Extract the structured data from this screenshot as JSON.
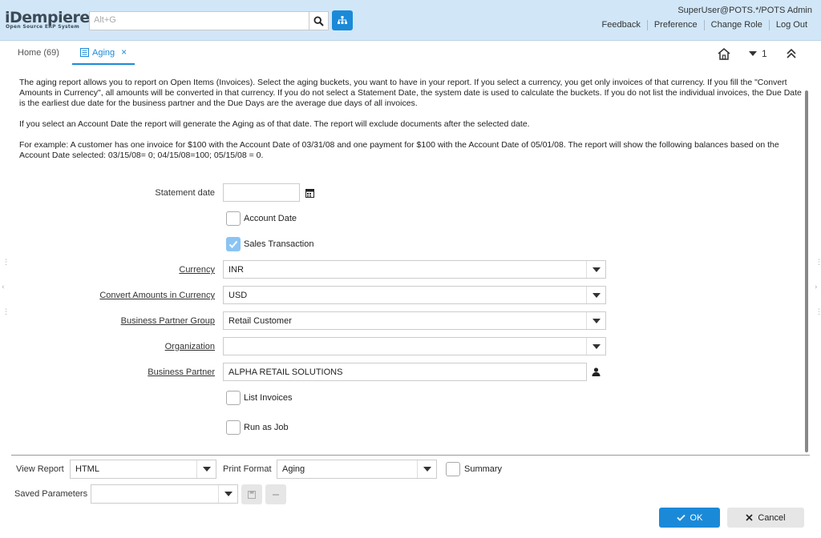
{
  "header": {
    "logo_text": "iDempiere",
    "logo_sub": "Open Source ERP System",
    "search_placeholder": "Alt+G",
    "user": "SuperUser@POTS.*/POTS Admin",
    "links": [
      "Feedback",
      "Preference",
      "Change Role",
      "Log Out"
    ]
  },
  "tabs": {
    "home_label": "Home (69)",
    "active_label": "Aging",
    "window_count": "1"
  },
  "description": {
    "p1": "The aging report allows you to report on Open Items (Invoices). Select the aging buckets, you want to have in your report. If you select a currency, you get only invoices of that currency. If you fill the \"Convert Amounts in Currency\", all amounts will be converted in that currency. If you do not select a Statement Date, the system date is used to calculate the buckets. If you do not list the individual invoices, the Due Date is the earliest due date for the business partner and the Due Days are the average due days of all invoices.",
    "p2": "If you select an Account Date the report will generate the Aging as of that date. The report will exclude documents after the selected date.",
    "p3": "For example: A customer has one invoice for $100 with the Account Date of 03/31/08 and one payment for $100 with the Account Date of 05/01/08. The report will show the following balances based on the Account Date selected: 03/15/08= 0; 04/15/08=100; 05/15/08 = 0."
  },
  "form": {
    "statement_date_label": "Statement date",
    "statement_date_value": "",
    "account_date_label": "Account Date",
    "account_date_checked": false,
    "sales_tx_label": "Sales Transaction",
    "sales_tx_checked": true,
    "currency_label": "Currency",
    "currency_value": "INR",
    "convert_label": "Convert Amounts in Currency",
    "convert_value": "USD",
    "bp_group_label": "Business Partner Group",
    "bp_group_value": "Retail Customer",
    "org_label": "Organization",
    "org_value": "",
    "bp_label": "Business Partner",
    "bp_value": "ALPHA RETAIL SOLUTIONS",
    "list_invoices_label": "List Invoices",
    "list_invoices_checked": false,
    "run_job_label": "Run as Job",
    "run_job_checked": false
  },
  "bottom": {
    "view_report_label": "View Report",
    "view_report_value": "HTML",
    "print_format_label": "Print Format",
    "print_format_value": "Aging",
    "summary_label": "Summary",
    "saved_params_label": "Saved Parameters",
    "saved_params_value": "",
    "ok_label": "OK",
    "cancel_label": "Cancel"
  },
  "colors": {
    "header_bg": "#d1e7f8",
    "accent": "#1a8ad8",
    "checked": "#89c4f4"
  }
}
